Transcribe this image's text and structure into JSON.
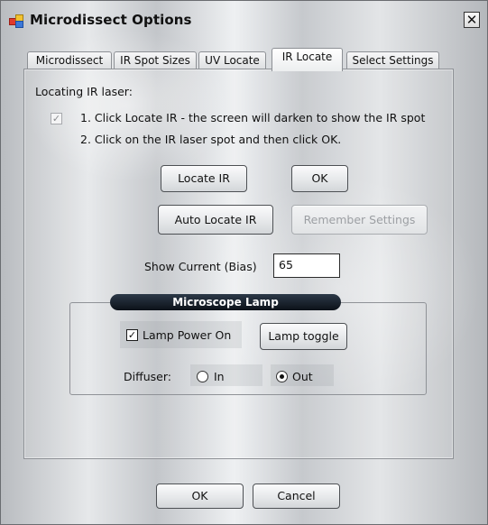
{
  "window": {
    "title": "Microdissect Options",
    "close_symbol": "✕"
  },
  "tabs": [
    {
      "label": "Microdissect",
      "active": false
    },
    {
      "label": "IR Spot Sizes",
      "active": false
    },
    {
      "label": "UV Locate",
      "active": false
    },
    {
      "label": "IR Locate",
      "active": true
    },
    {
      "label": "Select Settings",
      "active": false
    }
  ],
  "ir_locate": {
    "heading": "Locating IR laser:",
    "step1": "1. Click Locate IR - the screen will darken to show the IR spot",
    "step1_checked": true,
    "step2": "2. Click on the IR laser spot and then click OK.",
    "buttons": {
      "locate_ir": "Locate IR",
      "ok": "OK",
      "auto_locate_ir": "Auto Locate IR",
      "remember_settings": "Remember Settings"
    },
    "show_current_label": "Show Current (Bias)",
    "show_current_value": "65"
  },
  "microscope_lamp": {
    "title": "Microscope Lamp",
    "lamp_power_label": "Lamp Power On",
    "lamp_power_checked": true,
    "lamp_toggle": "Lamp toggle",
    "diffuser_label": "Diffuser:",
    "diffuser_options": [
      "In",
      "Out"
    ],
    "diffuser_selected": "Out"
  },
  "footer": {
    "ok": "OK",
    "cancel": "Cancel"
  }
}
